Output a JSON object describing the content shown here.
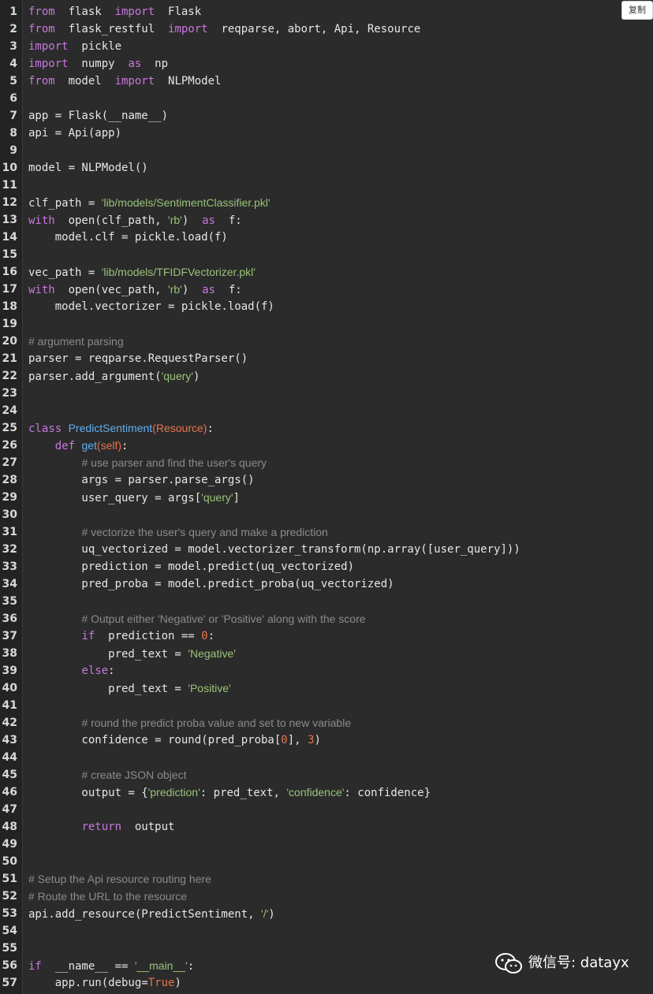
{
  "toolbar": {
    "copy_label": "复制"
  },
  "watermark": {
    "text": "微信号: datayx",
    "icon": "wechat-icon"
  },
  "colors": {
    "background": "#2b2b2b",
    "gutter": "#232323",
    "keyword": "#c678dd",
    "string": "#98c379",
    "number": "#e5734d",
    "function": "#61afef",
    "comment": "#8b8b8b",
    "text": "#e6e6e6"
  },
  "code": {
    "language": "python",
    "lines": [
      {
        "n": "1",
        "tokens": [
          [
            "kw",
            "from"
          ],
          [
            "",
            "  flask  "
          ],
          [
            "kw",
            "import"
          ],
          [
            "",
            "  Flask"
          ]
        ]
      },
      {
        "n": "2",
        "tokens": [
          [
            "kw",
            "from"
          ],
          [
            "",
            "  flask_restful  "
          ],
          [
            "kw",
            "import"
          ],
          [
            "",
            "  reqparse, abort, Api, Resource"
          ]
        ]
      },
      {
        "n": "3",
        "tokens": [
          [
            "kw",
            "import"
          ],
          [
            "",
            "  pickle"
          ]
        ]
      },
      {
        "n": "4",
        "tokens": [
          [
            "kw",
            "import"
          ],
          [
            "",
            "  numpy  "
          ],
          [
            "kw",
            "as"
          ],
          [
            "",
            "  np"
          ]
        ]
      },
      {
        "n": "5",
        "tokens": [
          [
            "kw",
            "from"
          ],
          [
            "",
            "  model  "
          ],
          [
            "kw",
            "import"
          ],
          [
            "",
            "  NLPModel"
          ]
        ]
      },
      {
        "n": "6",
        "tokens": []
      },
      {
        "n": "7",
        "tokens": [
          [
            "",
            "app = Flask(__name__)"
          ]
        ]
      },
      {
        "n": "8",
        "tokens": [
          [
            "",
            "api = Api(app)"
          ]
        ]
      },
      {
        "n": "9",
        "tokens": []
      },
      {
        "n": "10",
        "tokens": [
          [
            "",
            "model = NLPModel()"
          ]
        ]
      },
      {
        "n": "11",
        "tokens": []
      },
      {
        "n": "12",
        "tokens": [
          [
            "",
            "clf_path = "
          ],
          [
            "str",
            "'lib/models/SentimentClassifier.pkl'"
          ]
        ]
      },
      {
        "n": "13",
        "tokens": [
          [
            "kw",
            "with"
          ],
          [
            "",
            "  open(clf_path, "
          ],
          [
            "str",
            "'rb'"
          ],
          [
            "",
            ")  "
          ],
          [
            "kw",
            "as"
          ],
          [
            "",
            "  f:"
          ]
        ]
      },
      {
        "n": "14",
        "tokens": [
          [
            "",
            "    model.clf = pickle.load(f)"
          ]
        ]
      },
      {
        "n": "15",
        "tokens": []
      },
      {
        "n": "16",
        "tokens": [
          [
            "",
            "vec_path = "
          ],
          [
            "str",
            "'lib/models/TFIDFVectorizer.pkl'"
          ]
        ]
      },
      {
        "n": "17",
        "tokens": [
          [
            "kw",
            "with"
          ],
          [
            "",
            "  open(vec_path, "
          ],
          [
            "str",
            "'rb'"
          ],
          [
            "",
            ")  "
          ],
          [
            "kw",
            "as"
          ],
          [
            "",
            "  f:"
          ]
        ]
      },
      {
        "n": "18",
        "tokens": [
          [
            "",
            "    model.vectorizer = pickle.load(f)"
          ]
        ]
      },
      {
        "n": "19",
        "tokens": []
      },
      {
        "n": "20",
        "tokens": [
          [
            "com",
            "# argument parsing"
          ]
        ]
      },
      {
        "n": "21",
        "tokens": [
          [
            "",
            "parser = reqparse.RequestParser()"
          ]
        ]
      },
      {
        "n": "22",
        "tokens": [
          [
            "",
            "parser.add_argument("
          ],
          [
            "str",
            "'query'"
          ],
          [
            "",
            ")"
          ]
        ]
      },
      {
        "n": "23",
        "tokens": []
      },
      {
        "n": "24",
        "tokens": []
      },
      {
        "n": "25",
        "tokens": [
          [
            "kw",
            "class "
          ],
          [
            "fn",
            "PredictSentiment"
          ],
          [
            "cls",
            "(Resource)"
          ],
          [
            "",
            ":"
          ]
        ]
      },
      {
        "n": "26",
        "tokens": [
          [
            "",
            "    "
          ],
          [
            "kw",
            "def "
          ],
          [
            "fn",
            "get"
          ],
          [
            "cls",
            "(self)"
          ],
          [
            "",
            ":"
          ]
        ]
      },
      {
        "n": "27",
        "tokens": [
          [
            "",
            "        "
          ],
          [
            "com",
            "# use parser and find the user's query"
          ]
        ]
      },
      {
        "n": "28",
        "tokens": [
          [
            "",
            "        args = parser.parse_args()"
          ]
        ]
      },
      {
        "n": "29",
        "tokens": [
          [
            "",
            "        user_query = args["
          ],
          [
            "str",
            "'query'"
          ],
          [
            "",
            "]"
          ]
        ]
      },
      {
        "n": "30",
        "tokens": []
      },
      {
        "n": "31",
        "tokens": [
          [
            "",
            "        "
          ],
          [
            "com",
            "# vectorize the user's query and make a prediction"
          ]
        ]
      },
      {
        "n": "32",
        "tokens": [
          [
            "",
            "        uq_vectorized = model.vectorizer_transform(np.array([user_query]))"
          ]
        ]
      },
      {
        "n": "33",
        "tokens": [
          [
            "",
            "        prediction = model.predict(uq_vectorized)"
          ]
        ]
      },
      {
        "n": "34",
        "tokens": [
          [
            "",
            "        pred_proba = model.predict_proba(uq_vectorized)"
          ]
        ]
      },
      {
        "n": "35",
        "tokens": []
      },
      {
        "n": "36",
        "tokens": [
          [
            "",
            "        "
          ],
          [
            "com",
            "# Output either 'Negative' or 'Positive' along with the score"
          ]
        ]
      },
      {
        "n": "37",
        "tokens": [
          [
            "",
            "        "
          ],
          [
            "kw",
            "if"
          ],
          [
            "",
            "  prediction == "
          ],
          [
            "num",
            "0"
          ],
          [
            "",
            ":"
          ]
        ]
      },
      {
        "n": "38",
        "tokens": [
          [
            "",
            "            pred_text = "
          ],
          [
            "str",
            "'Negative'"
          ]
        ]
      },
      {
        "n": "39",
        "tokens": [
          [
            "",
            "        "
          ],
          [
            "kw",
            "else"
          ],
          [
            "",
            ":"
          ]
        ]
      },
      {
        "n": "40",
        "tokens": [
          [
            "",
            "            pred_text = "
          ],
          [
            "str",
            "'Positive'"
          ]
        ]
      },
      {
        "n": "41",
        "tokens": []
      },
      {
        "n": "42",
        "tokens": [
          [
            "",
            "        "
          ],
          [
            "com",
            "# round the predict proba value and set to new variable"
          ]
        ]
      },
      {
        "n": "43",
        "tokens": [
          [
            "",
            "        confidence = round(pred_proba["
          ],
          [
            "num",
            "0"
          ],
          [
            "",
            "], "
          ],
          [
            "num",
            "3"
          ],
          [
            "",
            ")"
          ]
        ]
      },
      {
        "n": "44",
        "tokens": []
      },
      {
        "n": "45",
        "tokens": [
          [
            "",
            "        "
          ],
          [
            "com",
            "# create JSON object"
          ]
        ]
      },
      {
        "n": "46",
        "tokens": [
          [
            "",
            "        output = {"
          ],
          [
            "str",
            "'prediction'"
          ],
          [
            "",
            ": pred_text, "
          ],
          [
            "str",
            "'confidence'"
          ],
          [
            "",
            ": confidence}"
          ]
        ]
      },
      {
        "n": "47",
        "tokens": []
      },
      {
        "n": "48",
        "tokens": [
          [
            "",
            "        "
          ],
          [
            "kw",
            "return"
          ],
          [
            "",
            "  output"
          ]
        ]
      },
      {
        "n": "49",
        "tokens": []
      },
      {
        "n": "50",
        "tokens": []
      },
      {
        "n": "51",
        "tokens": [
          [
            "com",
            "# Setup the Api resource routing here"
          ]
        ]
      },
      {
        "n": "52",
        "tokens": [
          [
            "com",
            "# Route the URL to the resource"
          ]
        ]
      },
      {
        "n": "53",
        "tokens": [
          [
            "",
            "api.add_resource(PredictSentiment, "
          ],
          [
            "str",
            "'/'"
          ],
          [
            "",
            ")"
          ]
        ]
      },
      {
        "n": "54",
        "tokens": []
      },
      {
        "n": "55",
        "tokens": []
      },
      {
        "n": "56",
        "tokens": [
          [
            "kw",
            "if"
          ],
          [
            "",
            "  __name__ == "
          ],
          [
            "str",
            "'__main__'"
          ],
          [
            "",
            ":"
          ]
        ]
      },
      {
        "n": "57",
        "tokens": [
          [
            "",
            "    app.run(debug="
          ],
          [
            "num",
            "True"
          ],
          [
            "",
            ")"
          ]
        ]
      }
    ]
  }
}
